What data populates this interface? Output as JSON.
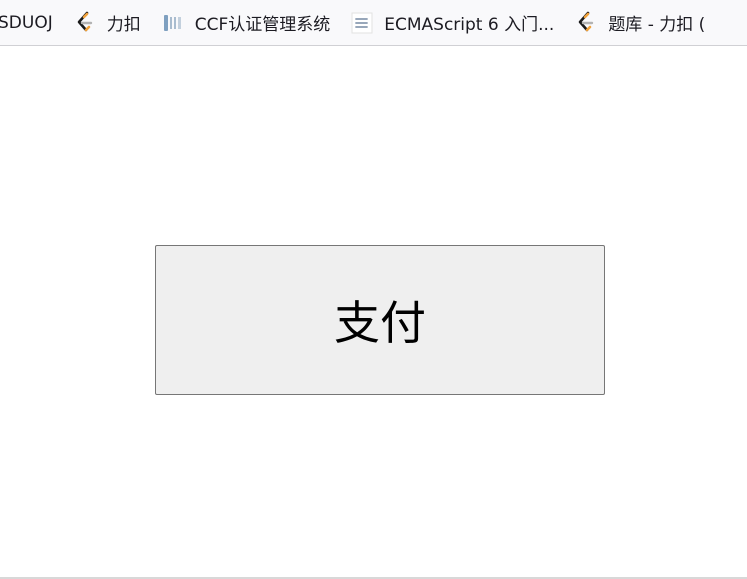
{
  "bookmarks": [
    {
      "label": "SDUOJ",
      "icon": "sduoj-icon"
    },
    {
      "label": "力扣",
      "icon": "leetcode-icon"
    },
    {
      "label": "CCF认证管理系统",
      "icon": "ccf-icon"
    },
    {
      "label": "ECMAScript 6 入门...",
      "icon": "ecmascript-icon"
    },
    {
      "label": "题库 - 力扣 (",
      "icon": "leetcode-icon"
    }
  ],
  "main": {
    "pay_button_label": "支付"
  },
  "colors": {
    "button_bg": "#efefef",
    "button_border": "#767676",
    "bookmarks_bg": "#f9f9fb"
  }
}
